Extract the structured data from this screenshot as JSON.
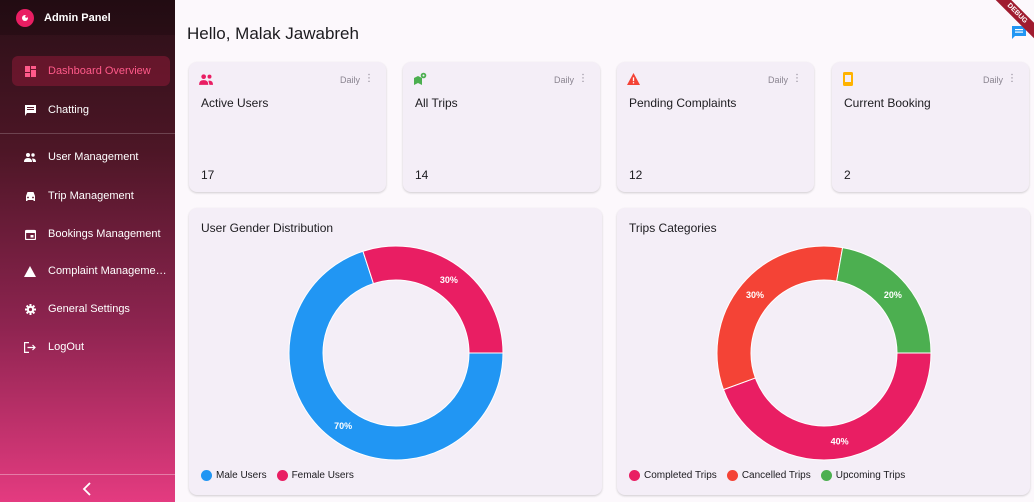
{
  "sidebar": {
    "title": "Admin Panel",
    "items": [
      {
        "label": "Dashboard Overview",
        "icon": "dashboard-icon"
      },
      {
        "label": "Chatting",
        "icon": "chat-icon"
      },
      {
        "label": "User Management",
        "icon": "people-icon"
      },
      {
        "label": "Trip Management",
        "icon": "car-icon"
      },
      {
        "label": "Bookings Management",
        "icon": "calendar-icon"
      },
      {
        "label": "Complaint Manageme…",
        "icon": "warning-icon"
      },
      {
        "label": "General Settings",
        "icon": "gear-icon"
      },
      {
        "label": "LogOut",
        "icon": "logout-icon"
      }
    ],
    "collapse_icon": "chevron-left-icon"
  },
  "header": {
    "greeting": "Hello, Malak Jawabreh",
    "ribbon": "DEBUG"
  },
  "stats": [
    {
      "title": "Active Users",
      "value": "17",
      "period": "Daily",
      "icon": "people-icon",
      "color": "#e91e63"
    },
    {
      "title": "All Trips",
      "value": "14",
      "period": "Daily",
      "icon": "map-pin-icon",
      "color": "#4caf50"
    },
    {
      "title": "Pending Complaints",
      "value": "12",
      "period": "Daily",
      "icon": "warning-icon",
      "color": "#f44336"
    },
    {
      "title": "Current Booking",
      "value": "2",
      "period": "Daily",
      "icon": "booking-icon",
      "color": "#ffb300"
    }
  ],
  "chart_data": [
    {
      "type": "pie",
      "title": "User Gender Distribution",
      "categories": [
        "Male Users",
        "Female Users"
      ],
      "values": [
        70,
        30
      ],
      "labels": [
        "70%",
        "30%"
      ],
      "colors": [
        "#2196f3",
        "#e91e63"
      ],
      "legend": "bottom-left"
    },
    {
      "type": "pie",
      "title": "Trips Categories",
      "categories": [
        "Completed Trips",
        "Cancelled Trips",
        "Upcoming Trips"
      ],
      "values": [
        40,
        30,
        20
      ],
      "labels": [
        "40%",
        "30%",
        "20%"
      ],
      "colors": [
        "#e91e63",
        "#f44336",
        "#4caf50"
      ],
      "legend": "bottom-left"
    }
  ],
  "colors": {
    "accent": "#e91e63",
    "card_bg": "#f4eef7",
    "page_bg": "#fcf8fc",
    "chat_icon": "#2196f3"
  }
}
